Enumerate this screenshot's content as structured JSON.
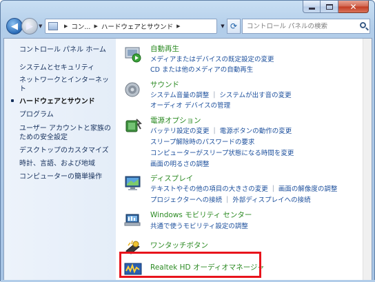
{
  "window": {
    "caption_buttons": [
      {
        "name": "minimize",
        "glyph": "minimize"
      },
      {
        "name": "maximize",
        "glyph": "maximize"
      },
      {
        "name": "close",
        "glyph": "✕"
      }
    ]
  },
  "navigation": {
    "back_icon": "arrow-left-icon",
    "forward_icon": "arrow-right-icon",
    "breadcrumb": [
      "コン...",
      "ハードウェアとサウンド"
    ],
    "refresh_icon": "refresh-icon",
    "search_placeholder": "コントロール パネルの検索"
  },
  "sidebar": {
    "items": [
      {
        "label": "コントロール パネル ホーム",
        "current": false
      },
      {
        "label": "システムとセキュリティ",
        "current": false
      },
      {
        "label": "ネットワークとインターネット",
        "current": false
      },
      {
        "label": "ハードウェアとサウンド",
        "current": true
      },
      {
        "label": "プログラム",
        "current": false
      },
      {
        "label": "ユーザー アカウントと家族のための安全設定",
        "current": false
      },
      {
        "label": "デスクトップのカスタマイズ",
        "current": false
      },
      {
        "label": "時計、言語、および地域",
        "current": false
      },
      {
        "label": "コンピューターの簡単操作",
        "current": false
      }
    ]
  },
  "categories": [
    {
      "title": "自動再生",
      "icon": "autoplay-icon",
      "lines": [
        [
          "メディアまたはデバイスの既定設定の変更"
        ],
        [
          "CD または他のメディアの自動再生"
        ]
      ]
    },
    {
      "title": "サウンド",
      "icon": "speaker-icon",
      "lines": [
        [
          "システム音量の調整",
          "システムが出す音の変更"
        ],
        [
          "オーディオ デバイスの管理"
        ]
      ]
    },
    {
      "title": "電源オプション",
      "icon": "power-options-icon",
      "lines": [
        [
          "バッテリ設定の変更",
          "電源ボタンの動作の変更"
        ],
        [
          "スリープ解除時のパスワードの要求"
        ],
        [
          "コンピューターがスリープ状態になる時間を変更"
        ],
        [
          "画面の明るさの調整"
        ]
      ]
    },
    {
      "title": "ディスプレイ",
      "icon": "display-icon",
      "lines": [
        [
          "テキストやその他の項目の大きさの変更",
          "画面の解像度の調整"
        ],
        [
          "プロジェクターへの接続",
          "外部ディスプレイへの接続"
        ]
      ]
    },
    {
      "title": "Windows モビリティ センター",
      "icon": "mobility-center-icon",
      "lines": [
        [
          "共通で使うモビリティ設定の調整"
        ]
      ]
    },
    {
      "title": "ワンタッチボタン",
      "icon": "one-touch-button-icon",
      "lines": []
    },
    {
      "title": "Realtek HD オーディオマネージャ",
      "icon": "realtek-audio-icon",
      "lines": []
    }
  ],
  "colors": {
    "category_title": "#2b8a22",
    "link": "#1c4f9c",
    "highlight_border": "#e8141c"
  }
}
